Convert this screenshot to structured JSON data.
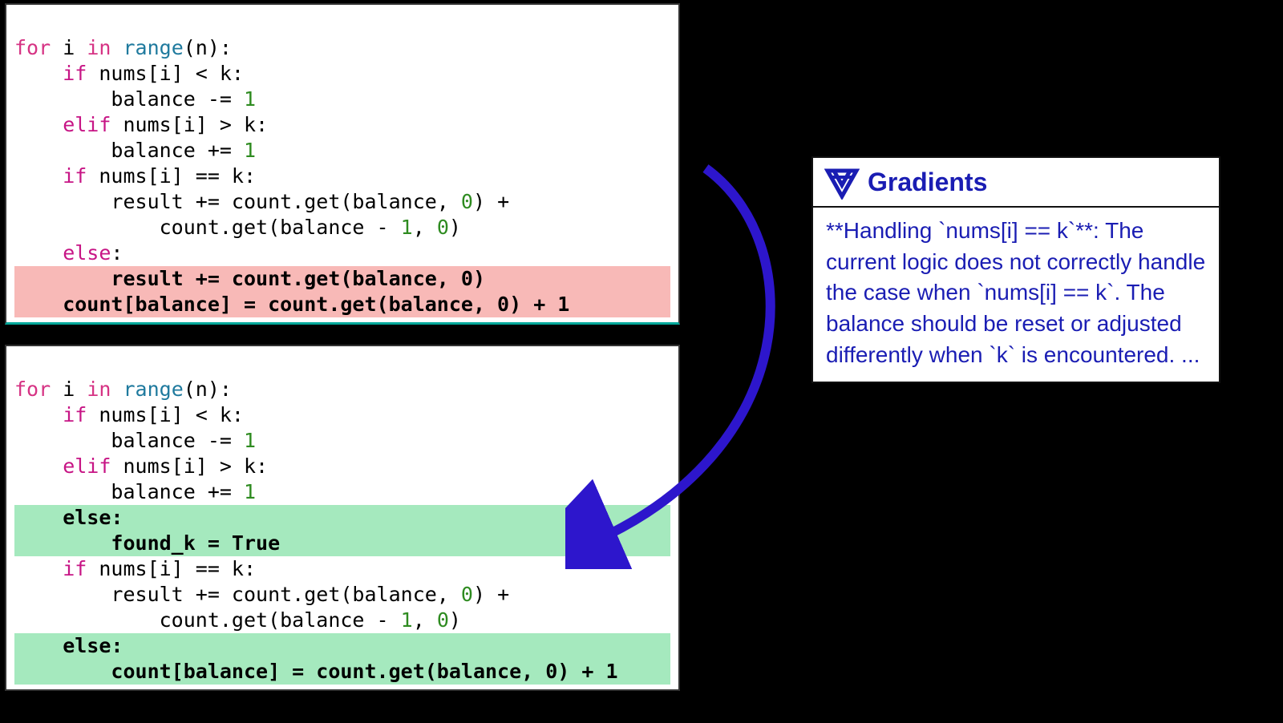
{
  "code1": {
    "line1_for": "for",
    "line1_in": "in",
    "line1_range": "range",
    "line1_rest_a": " i ",
    "line1_rest_b": " ",
    "line1_rest_c": "(n):",
    "line2_if": "    if",
    "line2_rest": " nums[i] < k:",
    "line3": "        balance -= ",
    "line3_num": "1",
    "line4_elif": "    elif",
    "line4_rest": " nums[i] > k:",
    "line5": "        balance += ",
    "line5_num": "1",
    "line6_if": "    if",
    "line6_rest": " nums[i] == k:",
    "line7": "        result += count.get(balance, ",
    "line7_num": "0",
    "line7_end": ") +",
    "line8": "            count.get(balance - ",
    "line8_num1": "1",
    "line8_mid": ", ",
    "line8_num0": "0",
    "line8_end": ")",
    "line9_else": "    else",
    "line9_colon": ":",
    "line10": "        result += count.get(balance, 0)",
    "line11": "    count[balance] = count.get(balance, 0) + 1"
  },
  "code2": {
    "line1_for": "for",
    "line1_in": "in",
    "line1_range": "range",
    "line1_rest_a": " i ",
    "line1_rest_b": " ",
    "line1_rest_c": "(n):",
    "line2_if": "    if",
    "line2_rest": " nums[i] < k:",
    "line3": "        balance -= ",
    "line3_num": "1",
    "line4_elif": "    elif",
    "line4_rest": " nums[i] > k:",
    "line5": "        balance += ",
    "line5_num": "1",
    "line6_else": "    else:",
    "line7": "        found_k = True",
    "line8_if": "    if",
    "line8_rest": " nums[i] == k:",
    "line9": "        result += count.get(balance, ",
    "line9_num": "0",
    "line9_end": ") +",
    "line10": "            count.get(balance - ",
    "line10_num1": "1",
    "line10_mid": ", ",
    "line10_num0": "0",
    "line10_end": ")",
    "line11_else": "    else:",
    "line12": "        count[balance] = count.get(balance, 0) + 1"
  },
  "gradients": {
    "title": "Gradients",
    "body": "**Handling `nums[i] == k`**: The current logic does not correctly handle the case when `nums[i] == k`. The balance should be reset or adjusted differently when `k` is encountered. ..."
  },
  "colors": {
    "accent": "#1a1db3",
    "red_hl": "#f8b9b7",
    "green_hl": "#a5e9be"
  }
}
